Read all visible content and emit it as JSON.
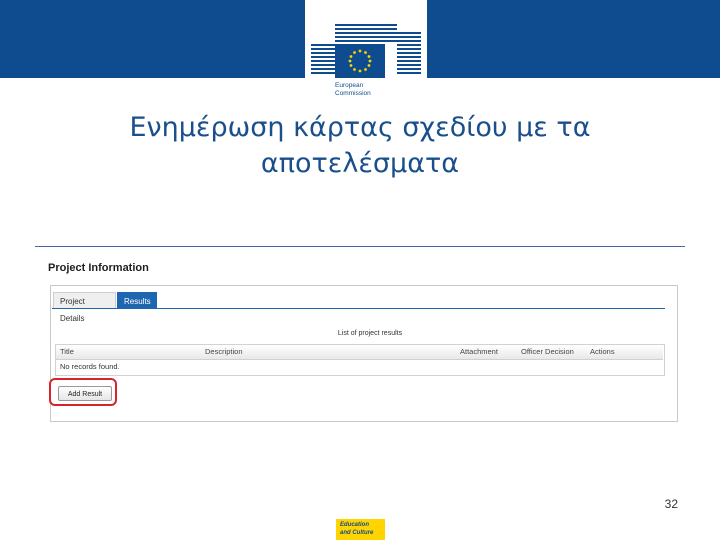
{
  "header": {
    "logo_line1": "European",
    "logo_line2": "Commission",
    "brand_color": "#0f4c8f"
  },
  "slide": {
    "title_line1": "Ενημέρωση κάρτας σχεδίου με τα",
    "title_line2": "αποτελέσματα",
    "page_number": "32",
    "footer_badge_line1": "Education",
    "footer_badge_line2": "and Culture"
  },
  "screenshot": {
    "heading": "Project Information",
    "tabs": [
      {
        "label": "Project Details",
        "active": false
      },
      {
        "label": "Results",
        "active": true
      }
    ],
    "list_title": "List of project results",
    "columns": [
      "Title",
      "Description",
      "Attachment",
      "Officer Decision",
      "Actions"
    ],
    "empty_message": "No records found.",
    "add_button": "Add Result",
    "highlight_color": "#d8232a"
  }
}
